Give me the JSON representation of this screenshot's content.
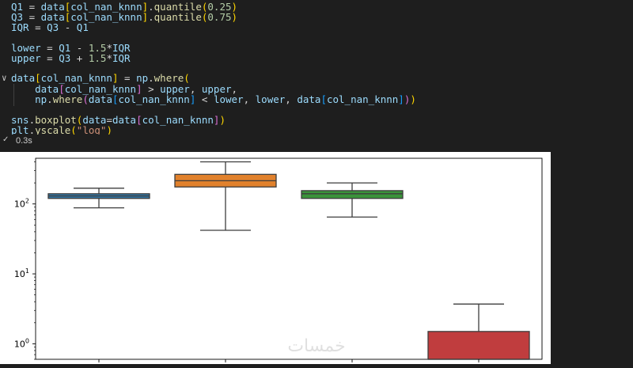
{
  "code": {
    "lines": [
      {
        "tokens": [
          [
            "v",
            "Q1"
          ],
          [
            "p",
            " = "
          ],
          [
            "v",
            "data"
          ],
          [
            "b1",
            "["
          ],
          [
            "v",
            "col_nan_knnn"
          ],
          [
            "b1",
            "]"
          ],
          [
            "p",
            "."
          ],
          [
            "f",
            "quantile"
          ],
          [
            "b1",
            "("
          ],
          [
            "n",
            "0.25"
          ],
          [
            "b1",
            ")"
          ]
        ]
      },
      {
        "tokens": [
          [
            "v",
            "Q3"
          ],
          [
            "p",
            " = "
          ],
          [
            "v",
            "data"
          ],
          [
            "b1",
            "["
          ],
          [
            "v",
            "col_nan_knnn"
          ],
          [
            "b1",
            "]"
          ],
          [
            "p",
            "."
          ],
          [
            "f",
            "quantile"
          ],
          [
            "b1",
            "("
          ],
          [
            "n",
            "0.75"
          ],
          [
            "b1",
            ")"
          ]
        ]
      },
      {
        "tokens": [
          [
            "v",
            "IQR"
          ],
          [
            "p",
            " = "
          ],
          [
            "v",
            "Q3"
          ],
          [
            "p",
            " - "
          ],
          [
            "v",
            "Q1"
          ]
        ]
      },
      {
        "tokens": []
      },
      {
        "tokens": [
          [
            "v",
            "lower"
          ],
          [
            "p",
            " = "
          ],
          [
            "v",
            "Q1"
          ],
          [
            "p",
            " - "
          ],
          [
            "n",
            "1.5"
          ],
          [
            "p",
            "*"
          ],
          [
            "v",
            "IQR"
          ]
        ]
      },
      {
        "tokens": [
          [
            "v",
            "upper"
          ],
          [
            "p",
            " = "
          ],
          [
            "v",
            "Q3"
          ],
          [
            "p",
            " + "
          ],
          [
            "n",
            "1.5"
          ],
          [
            "p",
            "*"
          ],
          [
            "v",
            "IQR"
          ]
        ]
      },
      {
        "tokens": []
      },
      {
        "tokens": [
          [
            "v",
            "data"
          ],
          [
            "b1",
            "["
          ],
          [
            "v",
            "col_nan_knnn"
          ],
          [
            "b1",
            "]"
          ],
          [
            "p",
            " = "
          ],
          [
            "v",
            "np"
          ],
          [
            "p",
            "."
          ],
          [
            "f",
            "where"
          ],
          [
            "b1",
            "("
          ]
        ]
      },
      {
        "tokens": [
          [
            "p",
            "    "
          ],
          [
            "v",
            "data"
          ],
          [
            "b2",
            "["
          ],
          [
            "v",
            "col_nan_knnn"
          ],
          [
            "b2",
            "]"
          ],
          [
            "p",
            " > "
          ],
          [
            "v",
            "upper"
          ],
          [
            "p",
            ", "
          ],
          [
            "v",
            "upper"
          ],
          [
            "p",
            ","
          ]
        ]
      },
      {
        "tokens": [
          [
            "p",
            "    "
          ],
          [
            "v",
            "np"
          ],
          [
            "p",
            "."
          ],
          [
            "f",
            "where"
          ],
          [
            "b2",
            "("
          ],
          [
            "v",
            "data"
          ],
          [
            "b3",
            "["
          ],
          [
            "v",
            "col_nan_knnn"
          ],
          [
            "b3",
            "]"
          ],
          [
            "p",
            " < "
          ],
          [
            "v",
            "lower"
          ],
          [
            "p",
            ", "
          ],
          [
            "v",
            "lower"
          ],
          [
            "p",
            ", "
          ],
          [
            "v",
            "data"
          ],
          [
            "b3",
            "["
          ],
          [
            "v",
            "col_nan_knnn"
          ],
          [
            "b3",
            "]"
          ],
          [
            "b2",
            ")"
          ],
          [
            "b1",
            ")"
          ]
        ]
      },
      {
        "tokens": []
      },
      {
        "tokens": [
          [
            "v",
            "sns"
          ],
          [
            "p",
            "."
          ],
          [
            "f",
            "boxplot"
          ],
          [
            "b1",
            "("
          ],
          [
            "v",
            "data"
          ],
          [
            "p",
            "="
          ],
          [
            "v",
            "data"
          ],
          [
            "b2",
            "["
          ],
          [
            "v",
            "col_nan_knnn"
          ],
          [
            "b2",
            "]"
          ],
          [
            "b1",
            ")"
          ]
        ]
      },
      {
        "tokens": [
          [
            "v",
            "plt"
          ],
          [
            "p",
            "."
          ],
          [
            "f",
            "yscale"
          ],
          [
            "b1",
            "("
          ],
          [
            "s",
            "\"log\""
          ],
          [
            "b1",
            ")"
          ]
        ]
      }
    ]
  },
  "execution": {
    "status_icon": "check-icon",
    "time": "0.3s"
  },
  "colors": {
    "background": "#1e1e1e",
    "plot_background": "#ffffff"
  },
  "watermark": "خمسات",
  "chart_data": {
    "type": "box",
    "yscale": "log",
    "ylim": [
      0.6,
      450
    ],
    "y_ticks": [
      {
        "base": "10",
        "exp": "2"
      },
      {
        "base": "10",
        "exp": "1"
      },
      {
        "base": "10",
        "exp": "0"
      }
    ],
    "grid": false,
    "boxes": [
      {
        "color": "#3274a1",
        "whisker_low": 88,
        "q1": 120,
        "median": 130,
        "q3": 140,
        "whisker_high": 168
      },
      {
        "color": "#e1812c",
        "whisker_low": 42,
        "q1": 175,
        "median": 215,
        "q3": 265,
        "whisker_high": 400
      },
      {
        "color": "#3a923a",
        "whisker_low": 65,
        "q1": 120,
        "median": 140,
        "q3": 155,
        "whisker_high": 200
      },
      {
        "color": "#c03d3e",
        "whisker_low": 0.3,
        "q1": 0.3,
        "median": 0.5,
        "q3": 1.5,
        "whisker_high": 3.7
      }
    ]
  }
}
